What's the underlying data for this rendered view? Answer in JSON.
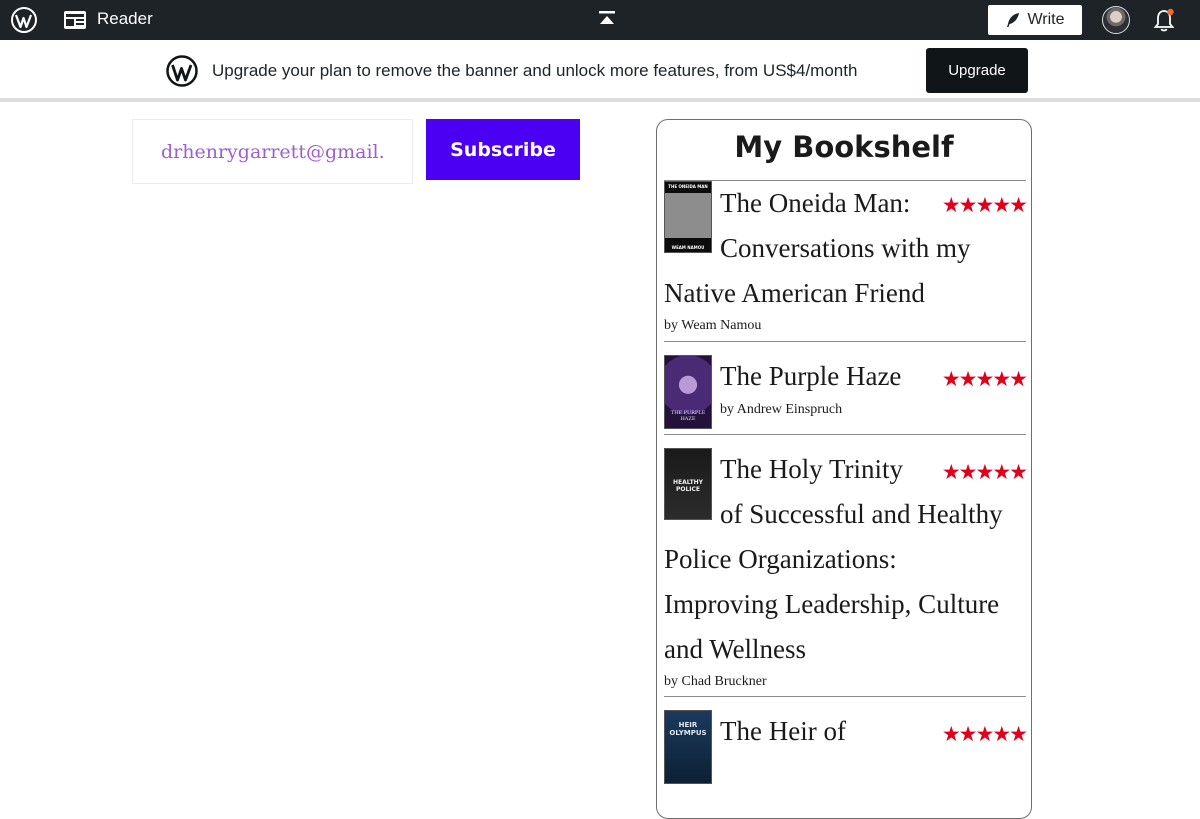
{
  "adminbar": {
    "reader_label": "Reader",
    "write_label": "Write"
  },
  "banner": {
    "text": "Upgrade your plan to remove the banner and unlock more features, from US$4/month",
    "button_label": "Upgrade"
  },
  "subscribe": {
    "email_value": "drhenrygarrett@gmail.com",
    "button_label": "Subscribe"
  },
  "bookshelf": {
    "title": "My Bookshelf",
    "stars": "★★★★★",
    "books": [
      {
        "title_line1": "The Oneida Man:",
        "title_line2": "Conversations with my",
        "title_line3": "Native American Friend",
        "author": "by Weam Namou",
        "cover_text_top": "THE ONEIDA MAN",
        "cover_text_bottom": "WEAM NAMOU",
        "rating": 5
      },
      {
        "title_line1": "The Purple Haze",
        "author": "by Andrew Einspruch",
        "cover_text": "THE PURPLE HAZE",
        "rating": 5
      },
      {
        "title_line1": "The Holy Trinity",
        "title_line2": "of Successful and Healthy",
        "title_line3": "Police Organizations:",
        "title_line4": "Improving Leadership, Culture",
        "title_line5": "and Wellness",
        "author": "by Chad Bruckner",
        "cover_text": "HEALTHY POLICE",
        "rating": 5
      },
      {
        "title_line1": "The Heir of",
        "cover_text": "HEIR OLYMPUS",
        "rating": 5
      }
    ]
  },
  "colors": {
    "adminbar_bg": "#1d2327",
    "subscribe_button": "#4b00f3",
    "star_color": "#e0001b",
    "email_text": "#9b5fd1"
  }
}
